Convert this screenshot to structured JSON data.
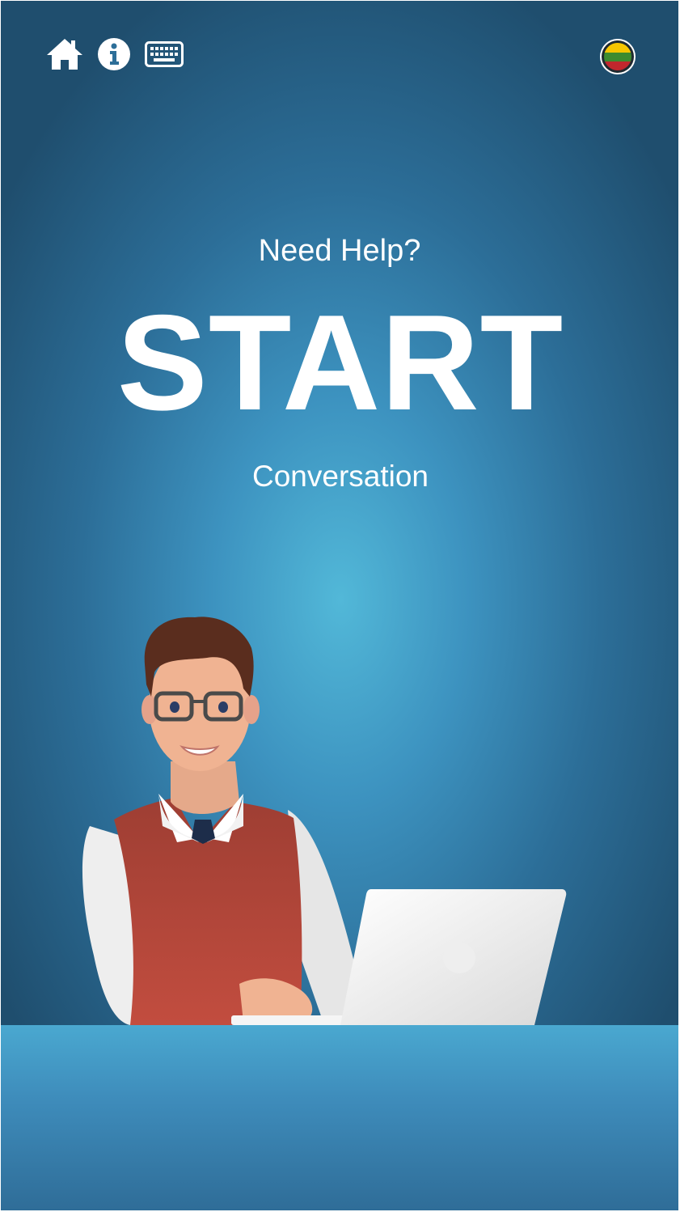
{
  "colors": {
    "background_center": "#52b8d8",
    "background_edge": "#1f4e6e",
    "text": "#ffffff",
    "desk": "#4aa8d0"
  },
  "toolbar": {
    "left_icons": [
      "home-icon",
      "info-icon",
      "keyboard-icon"
    ],
    "language_flag": "lithuania-flag-icon"
  },
  "hero": {
    "prompt": "Need Help?",
    "title": "START",
    "subtitle": "Conversation"
  }
}
